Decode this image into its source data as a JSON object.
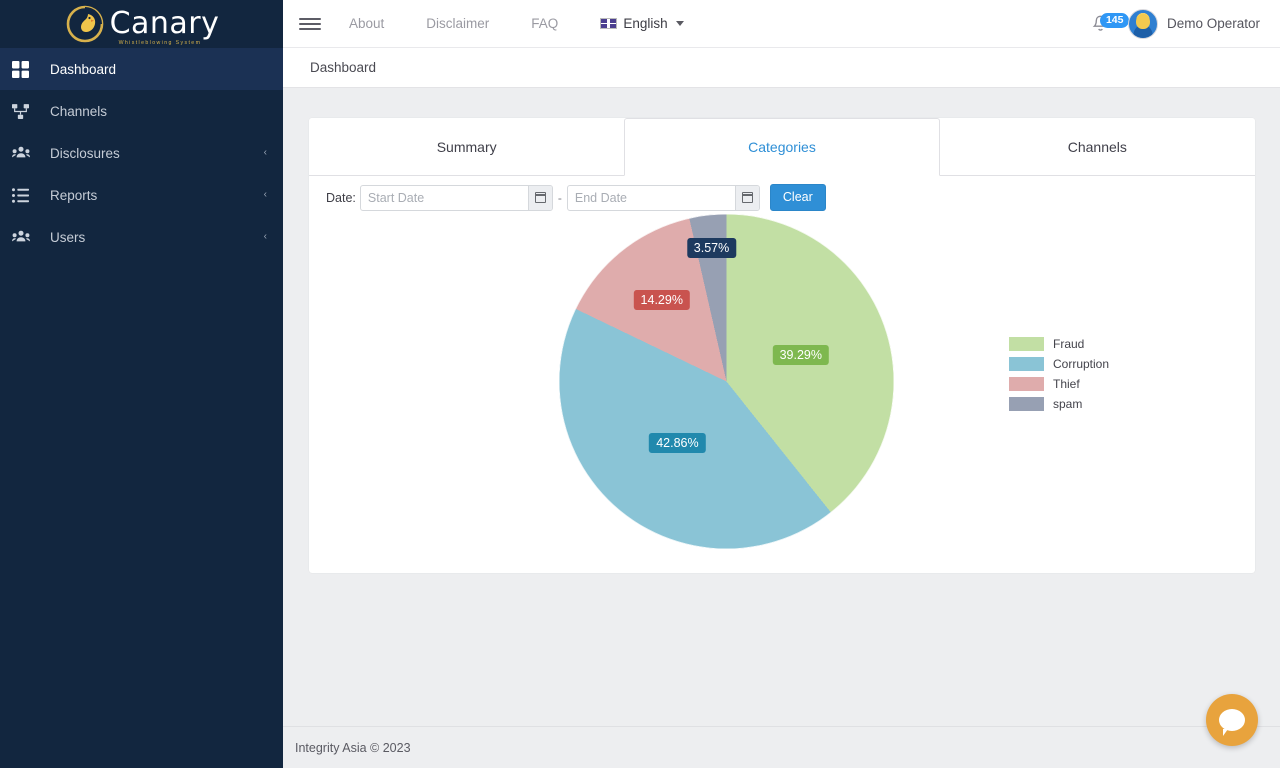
{
  "brand": {
    "name": "Canary",
    "tagline": "Whistleblowing System",
    "logo_icon": "canary-bird-logo"
  },
  "sidebar": {
    "items": [
      {
        "label": "Dashboard",
        "icon": "grid-icon",
        "active": true,
        "caret": ""
      },
      {
        "label": "Channels",
        "icon": "sitemap-icon",
        "active": false,
        "caret": ""
      },
      {
        "label": "Disclosures",
        "icon": "users-group-icon",
        "active": false,
        "caret": "‹"
      },
      {
        "label": "Reports",
        "icon": "list-icon",
        "active": false,
        "caret": "‹"
      },
      {
        "label": "Users",
        "icon": "users-group-icon",
        "active": false,
        "caret": "‹"
      }
    ]
  },
  "topbar": {
    "menu_icon": "hamburger-icon",
    "links": [
      "About",
      "Disclaimer",
      "FAQ"
    ],
    "language": {
      "label": "English",
      "flag_icon": "uk-flag-icon",
      "caret_icon": "chevron-down-icon"
    },
    "notifications": {
      "icon": "bell-icon",
      "count": "145"
    },
    "user": {
      "name": "Demo Operator",
      "avatar_icon": "user-avatar"
    }
  },
  "breadcrumb": {
    "current": "Dashboard"
  },
  "tabs": [
    {
      "label": "Summary",
      "active": false
    },
    {
      "label": "Categories",
      "active": true
    },
    {
      "label": "Channels",
      "active": false
    }
  ],
  "filter": {
    "label": "Date:",
    "start_placeholder": "Start Date",
    "start_value": "",
    "end_placeholder": "End Date",
    "end_value": "",
    "separator": "-",
    "calendar_icon": "calendar-icon",
    "clear_label": "Clear"
  },
  "chart_data": {
    "type": "pie",
    "title": "",
    "categories": [
      "Fraud",
      "Corruption",
      "Thief",
      "spam"
    ],
    "values": [
      39.29,
      42.86,
      14.29,
      3.57
    ],
    "labels": [
      "39.29%",
      "42.86%",
      "14.29%",
      "3.57%"
    ],
    "colors": [
      "#c2dfa4",
      "#8ac4d6",
      "#dfacac",
      "#97a0b3"
    ],
    "label_bg": [
      "#7eb84f",
      "#2189ad",
      "#c9534f",
      "#1d3a5f"
    ],
    "legend_position": "right",
    "grid": false
  },
  "footer": {
    "text": "Integrity Asia © 2023"
  },
  "chat": {
    "icon": "chat-bubble-icon"
  },
  "theme": {
    "sidebar_bg": "#12263f",
    "sidebar_active_bg": "#1b3154",
    "accent": "#2f8fd6",
    "page_bg": "#edeef0",
    "chat_bg": "#e8a33d"
  }
}
